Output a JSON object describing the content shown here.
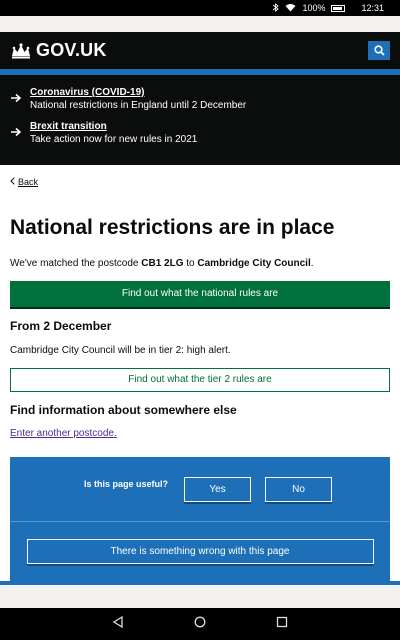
{
  "status_bar": {
    "battery": "100%",
    "time": "12:31",
    "icons": [
      "bluetooth-icon",
      "wifi-icon",
      "battery-icon"
    ]
  },
  "header": {
    "logo_text": "GOV.UK",
    "icons": [
      "crown-icon",
      "search-icon"
    ]
  },
  "banners": [
    {
      "title": "Coronavirus (COVID-19)",
      "description": "National restrictions in England until 2 December"
    },
    {
      "title": "Brexit transition",
      "description": "Take action now for new rules in 2021"
    }
  ],
  "main": {
    "back_label": "Back",
    "heading": "National restrictions are in place",
    "matched_prefix": "We've matched the postcode ",
    "postcode": "CB1 2LG",
    "matched_middle": " to ",
    "council": "Cambridge City Council",
    "matched_suffix": ".",
    "national_button": "Find out what the national rules are",
    "from_heading": "From 2 December",
    "tier_text": "Cambridge City Council will be in tier 2: high alert.",
    "tier_button": "Find out what the tier 2 rules are",
    "else_heading": "Find information about somewhere else",
    "enter_link": "Enter another postcode."
  },
  "feedback": {
    "question": "Is this page useful?",
    "yes": "Yes",
    "no": "No",
    "wrong": "There is something wrong with this page"
  },
  "colors": {
    "govuk_blue": "#1d70b8",
    "govuk_green": "#00703c",
    "link_purple": "#4c2c92",
    "header_black": "#0b0c0c"
  }
}
